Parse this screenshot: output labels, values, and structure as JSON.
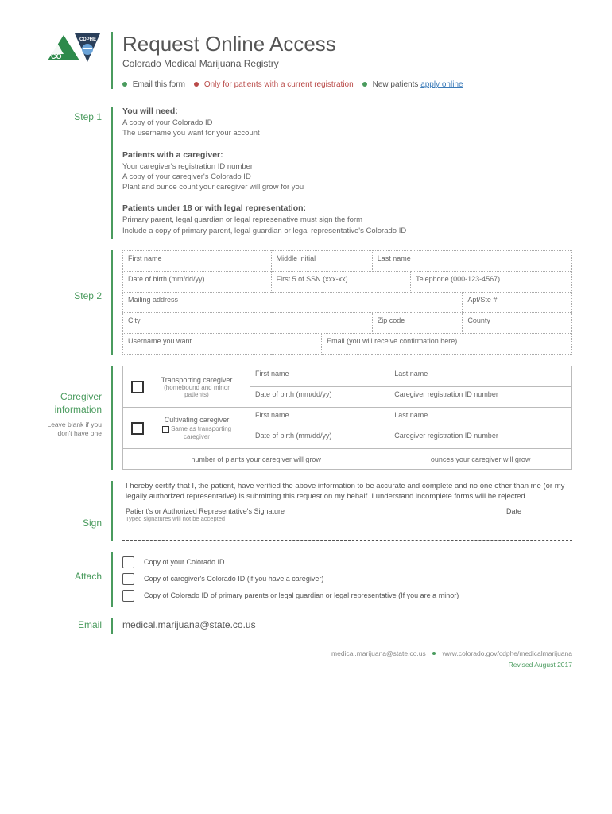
{
  "header": {
    "title": "Request Online Access",
    "subtitle": "Colorado Medical Marijuana Registry",
    "bullets": {
      "b1": "Email this form",
      "b2": "Only for patients with a current registration",
      "b3_prefix": "New patients ",
      "b3_link": "apply online"
    }
  },
  "step1": {
    "label": "Step 1",
    "need": {
      "hd": "You will need:",
      "l1": "A copy of your Colorado ID",
      "l2": "The username you want for your account"
    },
    "caregiver": {
      "hd": "Patients with a caregiver:",
      "l1": "Your caregiver's registration ID number",
      "l2": "A copy of your caregiver's Colorado ID",
      "l3": "Plant and ounce count your caregiver will grow for you"
    },
    "under18": {
      "hd": "Patients under 18 or with legal representation:",
      "l1": "Primary parent, legal guardian  or legal represenative must sign the form",
      "l2": "Include a copy of primary parent, legal guardian or legal representative's Colorado ID"
    }
  },
  "step2": {
    "label": "Step 2",
    "fields": {
      "first_name": "First name",
      "middle_initial": "Middle initial",
      "last_name": "Last name",
      "dob": "Date of birth (mm/dd/yy)",
      "ssn": "First 5 of SSN (xxx-xx)",
      "phone": "Telephone (000-123-4567)",
      "mailing": "Mailing address",
      "apt": "Apt/Ste #",
      "city": "City",
      "zip": "Zip code",
      "county": "County",
      "username": "Username you want",
      "email": "Email (you will receive confirmation here)"
    }
  },
  "caregiver_info": {
    "label": "Caregiver information",
    "sub": "Leave blank if you don't have one",
    "transporting": {
      "title": "Transporting caregiver",
      "sub": "(homebound and minor patients)"
    },
    "cultivating": {
      "title": "Cultivating caregiver",
      "same_as": "Same as transporting caregiver"
    },
    "fields": {
      "first_name": "First name",
      "last_name": "Last name",
      "dob": "Date of birth (mm/dd/yy)",
      "reg_id": "Caregiver registration ID number",
      "plants": "number of plants your caregiver will grow",
      "ounces": "ounces your caregiver will grow"
    }
  },
  "sign": {
    "label": "Sign",
    "cert": "I hereby certify that I, the patient, have verified the above information to be accurate and complete and no one other than me (or my legally authorized representative) is submitting this request on my behalf. I understand incomplete forms will be rejected.",
    "sig_label": "Patient's or Authorized Representative's Signature",
    "date_label": "Date",
    "note": "Typed signatures will not be accepted"
  },
  "attach": {
    "label": "Attach",
    "items": [
      "Copy of your Colorado ID",
      "Copy of caregiver's Colorado ID (if you have a caregiver)",
      "Copy of Colorado ID of primary parents or legal guardian or legal representative (If you are a minor)"
    ]
  },
  "email": {
    "label": "Email",
    "address": "medical.marijuana@state.co.us"
  },
  "footer": {
    "email": "medical.marijuana@state.co.us",
    "url": "www.colorado.gov/cdphe/medicalmarijuana",
    "revised": "Revised August 2017"
  }
}
